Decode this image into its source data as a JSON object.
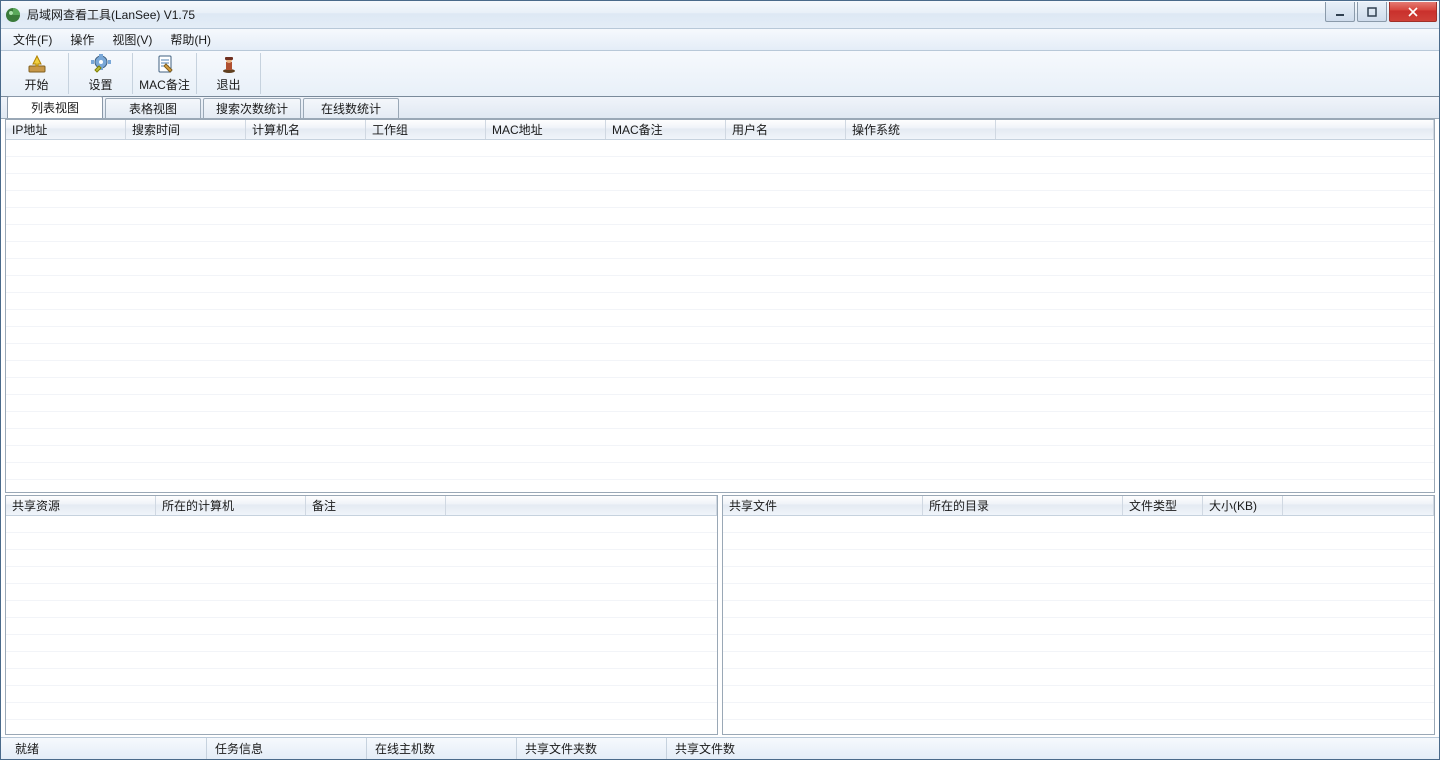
{
  "title": "局域网查看工具(LanSee) V1.75",
  "menu": {
    "file": "文件(F)",
    "operate": "操作",
    "view": "视图(V)",
    "help": "帮助(H)"
  },
  "toolbar": {
    "start": "开始",
    "settings": "设置",
    "mac_remark": "MAC备注",
    "exit": "退出"
  },
  "tabs": {
    "list_view": "列表视图",
    "table_view": "表格视图",
    "search_count": "搜索次数统计",
    "online_count": "在线数统计"
  },
  "main_columns": {
    "ip": "IP地址",
    "search_time": "搜索时间",
    "computer_name": "计算机名",
    "workgroup": "工作组",
    "mac_addr": "MAC地址",
    "mac_remark": "MAC备注",
    "username": "用户名",
    "os": "操作系统",
    "extra": ""
  },
  "left_panel_columns": {
    "share_resource": "共享资源",
    "computer": "所在的计算机",
    "remark": "备注",
    "extra": ""
  },
  "right_panel_columns": {
    "share_file": "共享文件",
    "directory": "所在的目录",
    "file_type": "文件类型",
    "size_kb": "大小(KB)",
    "extra": ""
  },
  "status": {
    "ready": "就绪",
    "task_info": "任务信息",
    "online_hosts": "在线主机数",
    "share_folders": "共享文件夹数",
    "share_files": "共享文件数"
  }
}
